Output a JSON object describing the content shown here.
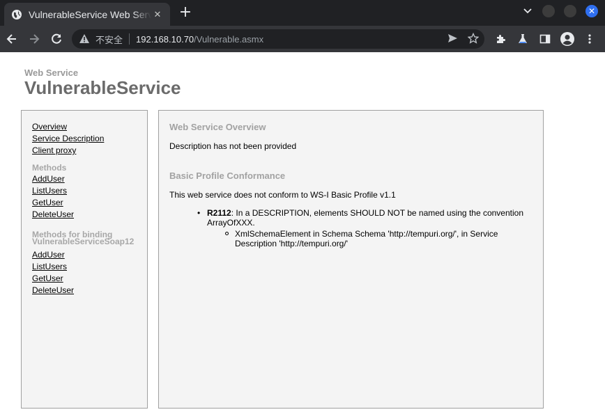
{
  "browser": {
    "tab_title": "VulnerableService Web Service",
    "security_label": "不安全",
    "url_host": "192.168.10.70",
    "url_path": "/Vulnerable.asmx",
    "colors": {
      "frame": "#202124",
      "toolbar": "#35363a",
      "close_btn": "#2f6ff0"
    }
  },
  "page": {
    "kicker": "Web Service",
    "title": "VulnerableService"
  },
  "sidebar": {
    "links": [
      "Overview",
      "Service Description",
      "Client proxy"
    ],
    "methods_heading": "Methods",
    "methods": [
      "AddUser",
      "ListUsers",
      "GetUser",
      "DeleteUser"
    ],
    "binding_heading_line1": "Methods for binding",
    "binding_heading_line2": "VulnerableServiceSoap12",
    "binding_methods": [
      "AddUser",
      "ListUsers",
      "GetUser",
      "DeleteUser"
    ]
  },
  "content": {
    "overview_heading": "Web Service Overview",
    "overview_text": "Description has not been provided",
    "conformance_heading": "Basic Profile Conformance",
    "conformance_text": "This web service does not conform to WS-I Basic Profile v1.1",
    "rule_id": "R2112",
    "rule_text": ": In a DESCRIPTION, elements SHOULD NOT be named using the convention ArrayOfXXX.",
    "rule_detail": "XmlSchemaElement in Schema Schema 'http://tempuri.org/', in Service Description 'http://tempuri.org/'"
  }
}
